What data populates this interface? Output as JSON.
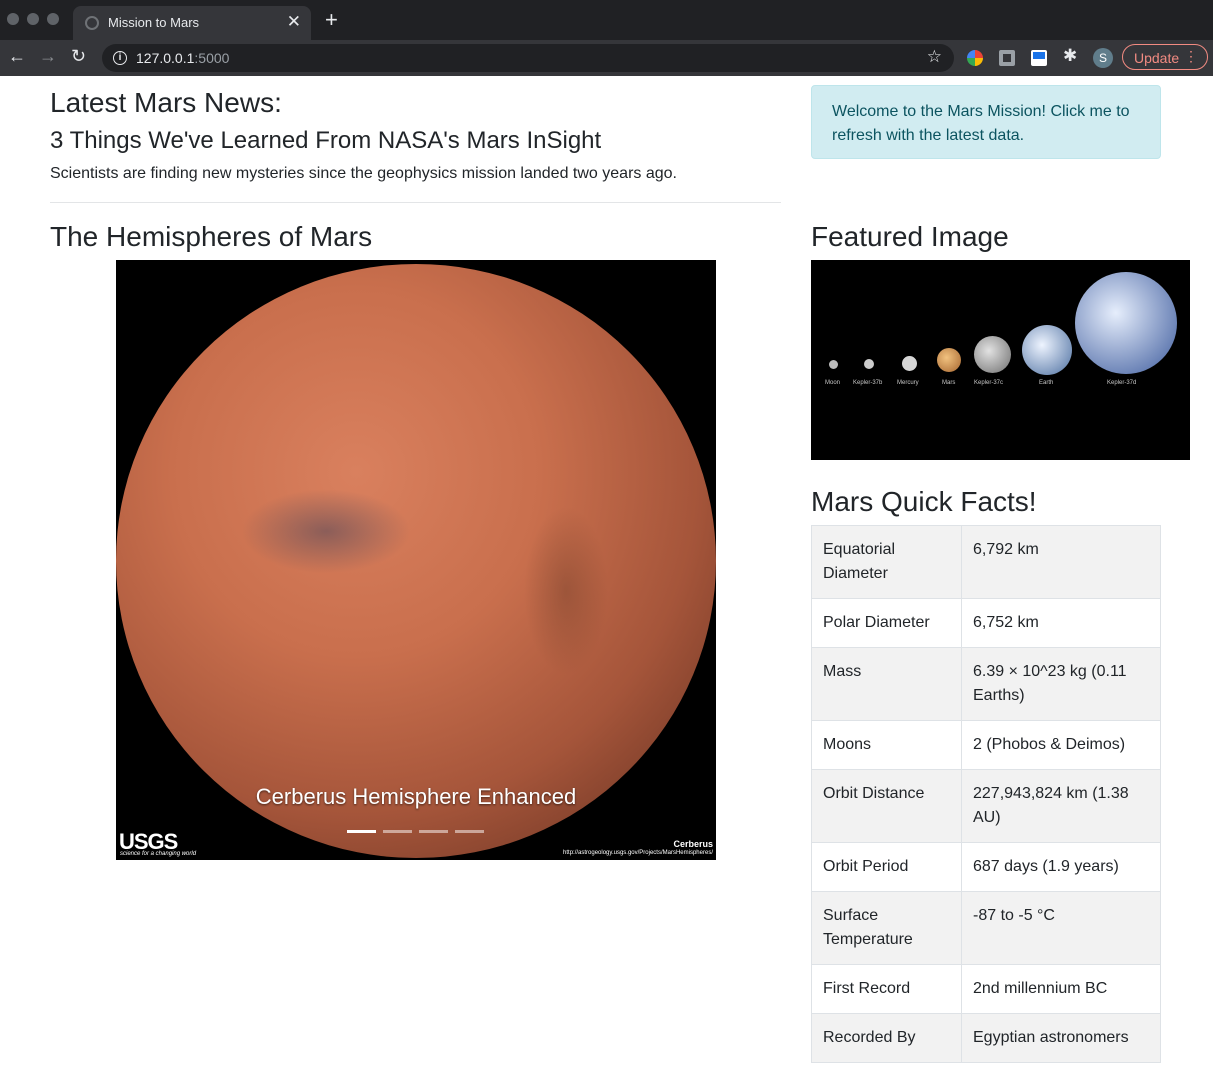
{
  "browser": {
    "tab_title": "Mission to Mars",
    "url_host": "127.0.0.1",
    "url_port": ":5000",
    "profile_initial": "S",
    "update_label": "Update"
  },
  "news": {
    "heading": "Latest Mars News:",
    "title": "3 Things We've Learned From NASA's Mars InSight",
    "paragraph": "Scientists are finding new mysteries since the geophysics mission landed two years ago."
  },
  "alert": {
    "text": "Welcome to the Mars Mission! Click me to refresh with the latest data."
  },
  "hemispheres": {
    "heading": "The Hemispheres of Mars",
    "caption": "Cerberus Hemisphere Enhanced",
    "active_slide": 1,
    "slide_count": 4,
    "usgs_logo": "USGS",
    "usgs_tagline": "science for a changing world",
    "image_label": "Cerberus",
    "image_url": "http://astrogeology.usgs.gov/Projects/MarsHemispheres/"
  },
  "featured": {
    "heading": "Featured Image",
    "labels": [
      "Moon",
      "Kepler-37b",
      "Mercury",
      "Mars",
      "Kepler-37c",
      "Earth",
      "Kepler-37d"
    ]
  },
  "facts": {
    "heading": "Mars Quick Facts!",
    "rows": [
      {
        "key": "Equatorial Diameter",
        "value": "6,792 km"
      },
      {
        "key": "Polar Diameter",
        "value": "6,752 km"
      },
      {
        "key": "Mass",
        "value": "6.39 × 10^23 kg (0.11 Earths)"
      },
      {
        "key": "Moons",
        "value": "2 (Phobos & Deimos)"
      },
      {
        "key": "Orbit Distance",
        "value": "227,943,824 km (1.38 AU)"
      },
      {
        "key": "Orbit Period",
        "value": "687 days (1.9 years)"
      },
      {
        "key": "Surface Temperature",
        "value": "-87 to -5 °C"
      },
      {
        "key": "First Record",
        "value": "2nd millennium BC"
      },
      {
        "key": "Recorded By",
        "value": "Egyptian astronomers"
      }
    ]
  },
  "colors": {
    "chrome_dark": "#202124",
    "chrome_tab": "#35363a",
    "alert_bg": "#d1ecf1",
    "alert_text": "#0c5460",
    "update_accent": "#f28b82"
  }
}
